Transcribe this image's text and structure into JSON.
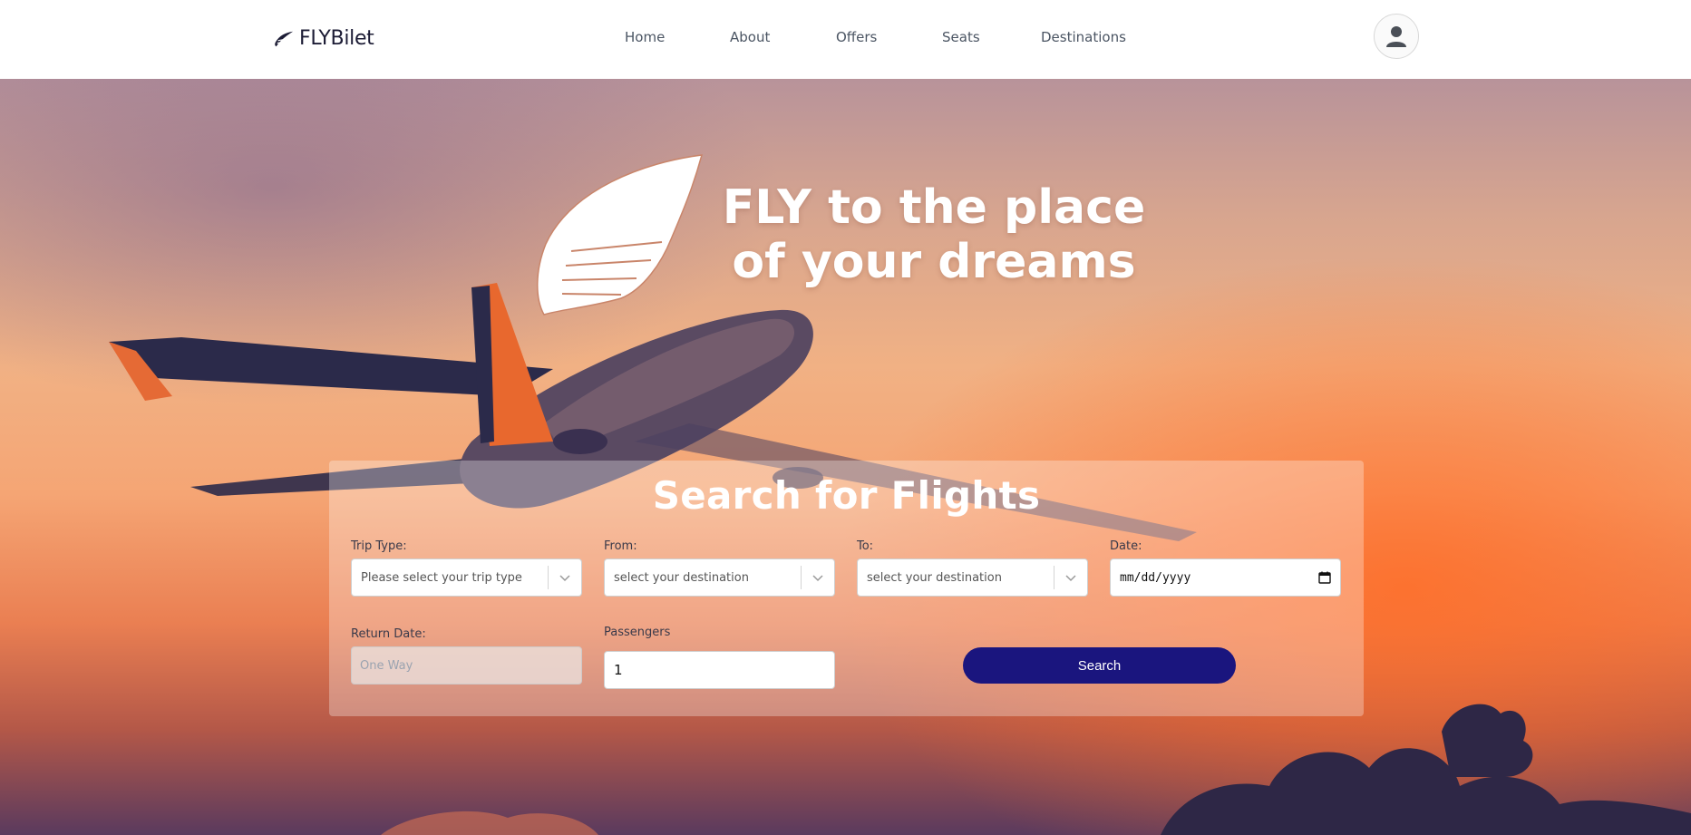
{
  "navbar": {
    "brand_name": "FLYBilet",
    "brand_icon": "wing-logo-icon",
    "links": [
      {
        "label": "Home"
      },
      {
        "label": "About"
      },
      {
        "label": "Offers"
      },
      {
        "label": "Seats"
      },
      {
        "label": "Destinations"
      }
    ],
    "profile_icon": "user-avatar-icon"
  },
  "hero": {
    "title_line1": "FLY to the place",
    "title_line2": "of your dreams",
    "logo_icon": "wing-logo-icon"
  },
  "search": {
    "title": "Search for Flights",
    "trip_type": {
      "label": "Trip Type:",
      "placeholder": "Please select your trip type"
    },
    "from": {
      "label": "From:",
      "placeholder": "select your destination"
    },
    "to": {
      "label": "To:",
      "placeholder": "select your destination"
    },
    "date": {
      "label": "Date:",
      "placeholder": "mm/dd/yyyy"
    },
    "return_date": {
      "label": "Return Date:",
      "placeholder": "One Way"
    },
    "passengers": {
      "label": "Passengers",
      "value": "1"
    },
    "button_label": "Search"
  },
  "colors": {
    "button": "#1a157e",
    "brand_text": "#1c1c35",
    "nav_text": "#4b5563"
  }
}
